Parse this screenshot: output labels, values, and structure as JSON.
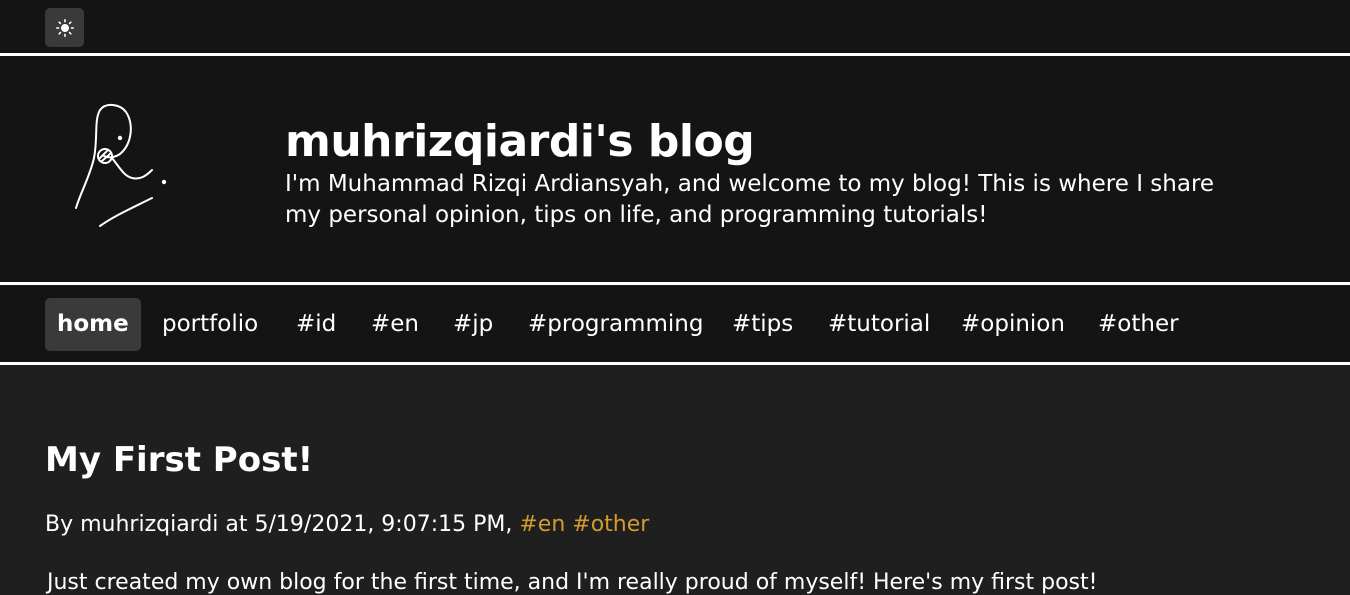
{
  "theme_toggle": {
    "icon": "sun-icon"
  },
  "header": {
    "title": "muhrizqiardi's blog",
    "description": "I'm Muhammad Rizqi Ardiansyah, and welcome to my blog! This is where I share\nmy personal opinion, tips on life, and programming tutorials!"
  },
  "nav": {
    "items": [
      {
        "label": "home"
      },
      {
        "label": "portfolio"
      },
      {
        "label": "#id"
      },
      {
        "label": "#en"
      },
      {
        "label": "#jp"
      },
      {
        "label": "#programming"
      },
      {
        "label": "#tips"
      },
      {
        "label": "#tutorial"
      },
      {
        "label": "#opinion"
      },
      {
        "label": "#other"
      }
    ]
  },
  "post": {
    "title": "My First Post!",
    "meta_prefix": "By muhrizqiardi at 5/19/2021, 9:07:15 PM,",
    "tags": [
      "#en",
      "#other"
    ],
    "excerpt": "Just created my own blog for the first time, and I'm really proud of myself! Here's my first post!"
  },
  "colors": {
    "background": "#1f1f1f",
    "header_background": "#141414",
    "active_nav": "#3a3a3a",
    "tag": "#d39b2c",
    "text": "#ffffff"
  }
}
